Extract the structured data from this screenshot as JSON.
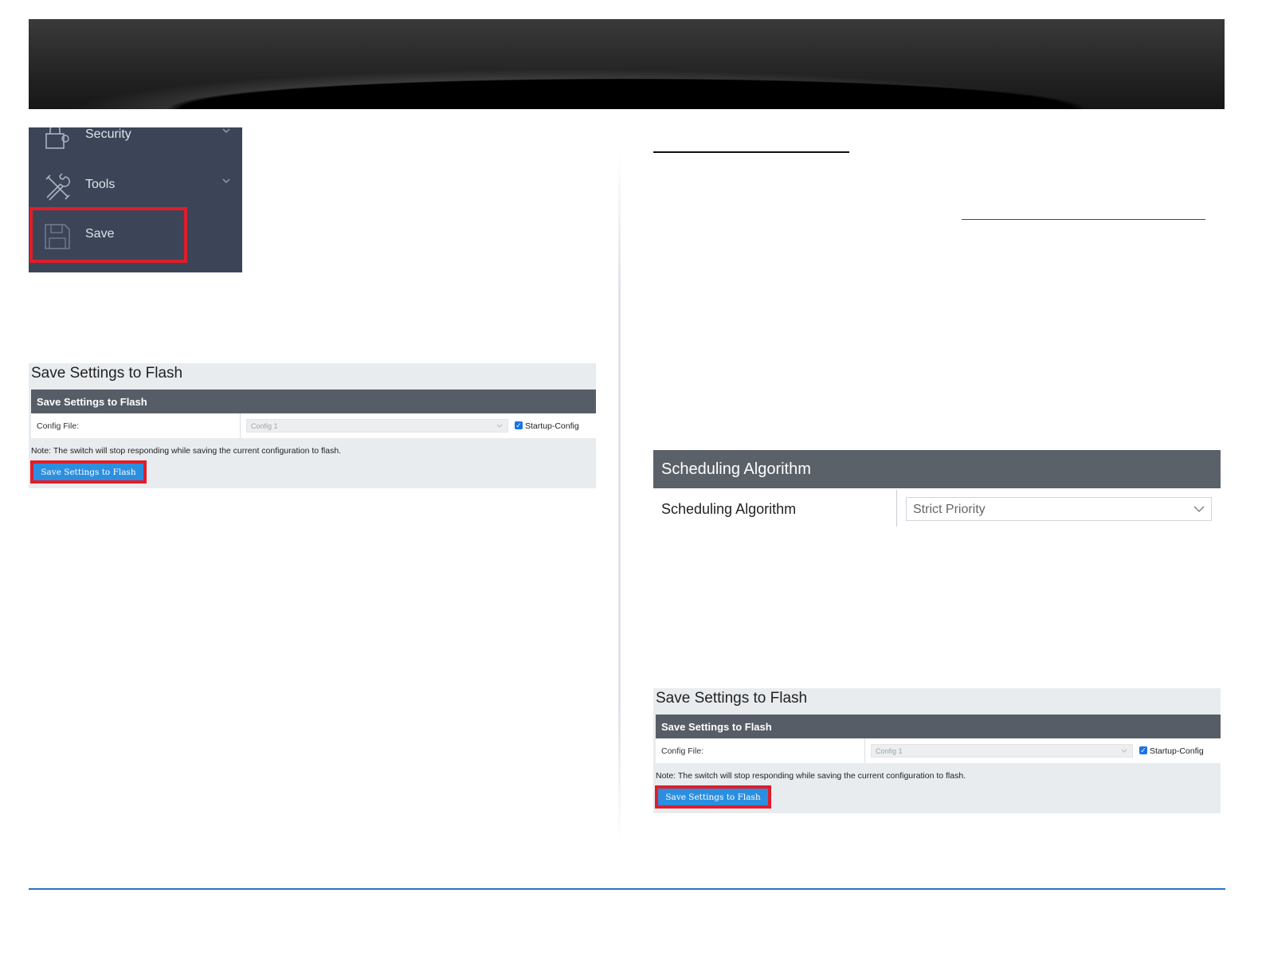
{
  "menu": {
    "items": [
      {
        "label": "Security",
        "icon": "lock-icon",
        "chevron": "chevron-down-icon"
      },
      {
        "label": "Tools",
        "icon": "tools-icon",
        "chevron": "chevron-down-icon"
      },
      {
        "label": "Save",
        "icon": "floppy-disk-icon"
      }
    ],
    "highlighted_item": "Save"
  },
  "save_panel": {
    "title": "Save Settings to Flash",
    "header": "Save Settings to Flash",
    "config_file_label": "Config File:",
    "config_file_value": "Config 1",
    "startup_config_label": "Startup-Config",
    "startup_config_checked": true,
    "note": "Note: The switch will stop responding while saving the current configuration to flash.",
    "button_label": "Save Settings to Flash"
  },
  "scheduling": {
    "header": "Scheduling Algorithm",
    "label": "Scheduling Algorithm",
    "value": "Strict Priority"
  },
  "colors": {
    "highlight": "#e11d2a",
    "button": "#2b8fe0",
    "menu_bg": "#3b4557",
    "panel_header": "#575d66",
    "footer_rule": "#2a73c5"
  }
}
